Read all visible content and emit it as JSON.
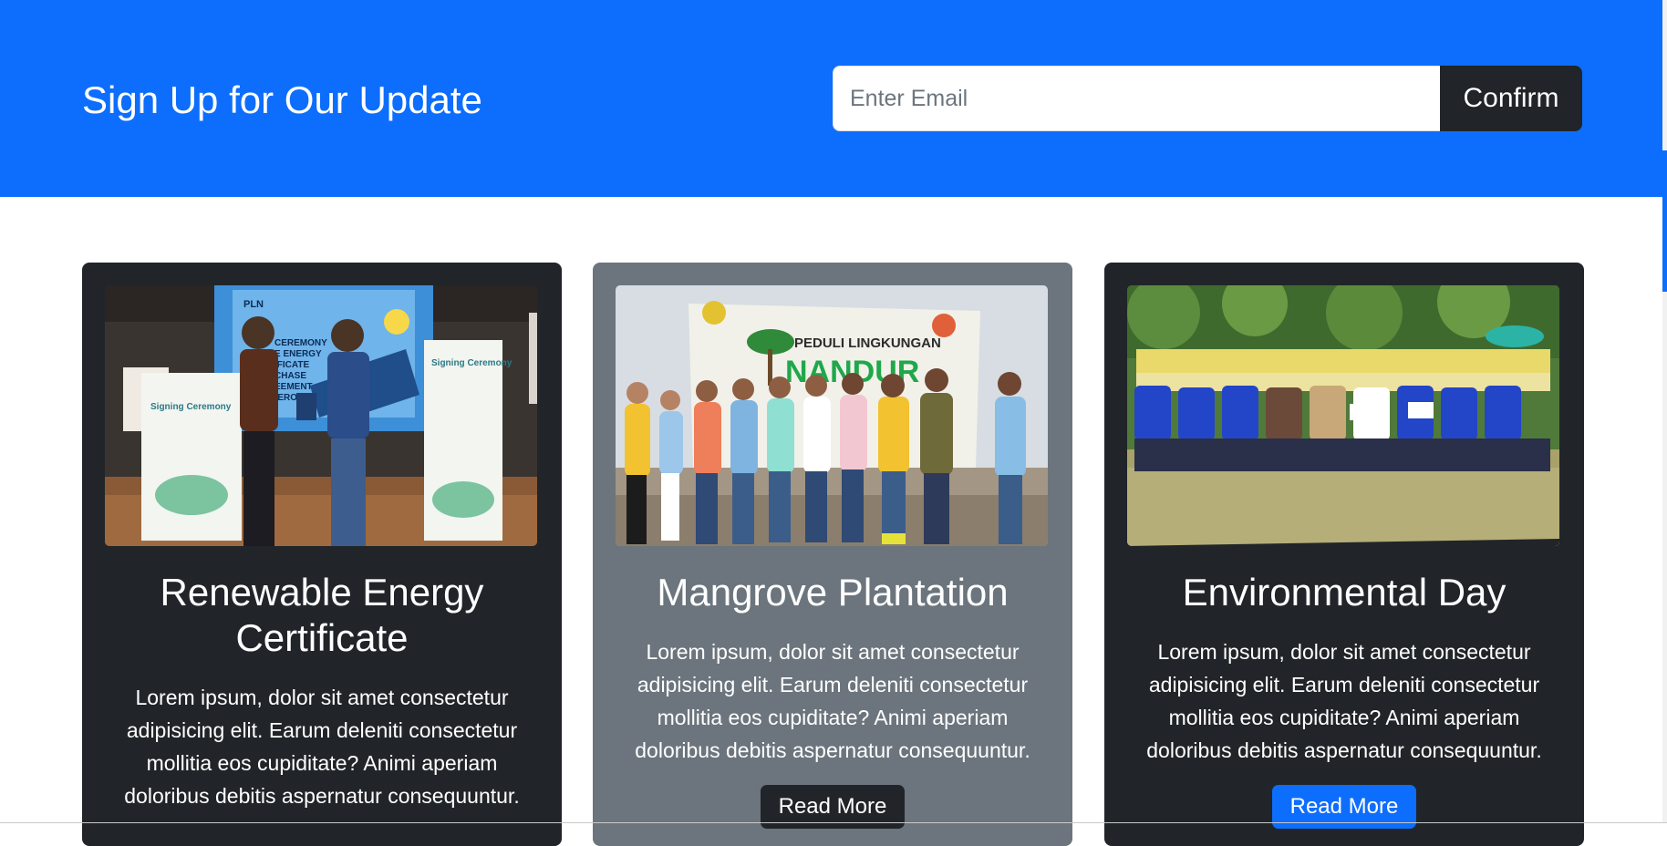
{
  "signup": {
    "title": "Sign Up for Our Update",
    "email_placeholder": "Enter Email",
    "email_value": "",
    "confirm_label": "Confirm"
  },
  "cards": [
    {
      "title": "Renewable Energy Certificate",
      "text": "Lorem ipsum, dolor sit amet consectetur adipisicing elit. Earum deleniti consectetur mollitia eos cupiditate? Animi aperiam doloribus debitis aspernatur consequuntur.",
      "image_text": {
        "banner_heading": "Signing Ceremony",
        "banner_brand": "PLN",
        "screen_lines": [
          "CEREMONY",
          "E ENERGY",
          "IFICATE",
          "CHASE",
          "EEMENT",
          "(ERO)"
        ]
      }
    },
    {
      "title": "Mangrove Plantation",
      "text": "Lorem ipsum, dolor sit amet consectetur adipisicing elit. Earum deleniti consectetur mollitia eos cupiditate? Animi aperiam doloribus debitis aspernatur consequuntur.",
      "button_label": "Read More",
      "image_text": {
        "banner_line1": "PEDULI LINGKUNGAN",
        "banner_line2": "NANDUR"
      }
    },
    {
      "title": "Environmental Day",
      "text": "Lorem ipsum, dolor sit amet consectetur adipisicing elit. Earum deleniti consectetur mollitia eos cupiditate? Animi aperiam doloribus debitis aspernatur consequuntur.",
      "button_label": "Read More"
    }
  ],
  "colors": {
    "primary": "#0d6efd",
    "dark": "#212529",
    "secondary": "#6c757d"
  }
}
